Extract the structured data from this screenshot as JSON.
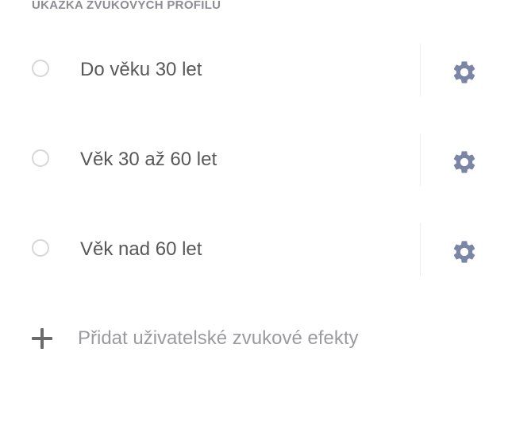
{
  "section": {
    "header": "UKÁZKA ZVUKOVÝCH PROFILŮ"
  },
  "profiles": [
    {
      "label": "Do věku 30 let",
      "selected": false,
      "settings_icon": "gear-icon"
    },
    {
      "label": "Věk 30 až 60 let",
      "selected": false,
      "settings_icon": "gear-icon"
    },
    {
      "label": "Věk nad 60 let",
      "selected": false,
      "settings_icon": "gear-icon"
    }
  ],
  "add": {
    "icon": "plus-icon",
    "label": "Přidat uživatelské zvukové efekty"
  },
  "colors": {
    "gear_icon": "#7b86a6",
    "radio_border": "#d7d7db",
    "label_text": "#585858",
    "add_text": "#9a9a9f",
    "plus_icon": "#6b6b6b",
    "header_text": "#8c8c94"
  }
}
